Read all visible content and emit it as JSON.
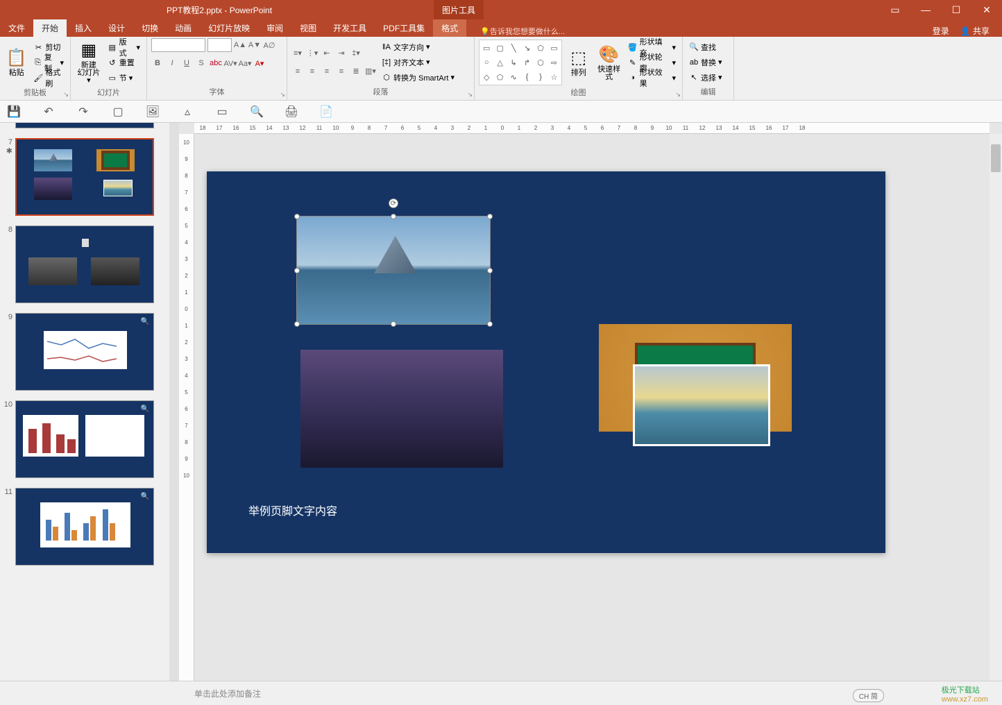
{
  "app": {
    "title": "PPT教程2.pptx - PowerPoint",
    "context_tool": "图片工具"
  },
  "tabs": {
    "file": "文件",
    "home": "开始",
    "insert": "插入",
    "design": "设计",
    "transitions": "切换",
    "animations": "动画",
    "slideshow": "幻灯片放映",
    "review": "审阅",
    "view": "视图",
    "developer": "开发工具",
    "pdf": "PDF工具集",
    "format": "格式"
  },
  "tell_me": "告诉我您想要做什么...",
  "header_right": {
    "login": "登录",
    "share": "共享"
  },
  "ribbon": {
    "clipboard": {
      "label": "剪贴板",
      "paste": "粘贴",
      "cut": "剪切",
      "copy": "复制",
      "format_painter": "格式刷"
    },
    "slides": {
      "label": "幻灯片",
      "new_slide": "新建",
      "new_slide2": "幻灯片",
      "layout": "版式",
      "reset": "重置",
      "section": "节"
    },
    "font": {
      "label": "字体"
    },
    "paragraph": {
      "label": "段落",
      "text_direction": "文字方向",
      "align_text": "对齐文本",
      "convert_smartart": "转换为 SmartArt"
    },
    "drawing": {
      "label": "绘图",
      "arrange": "排列",
      "quick_styles": "快速样式",
      "shape_fill": "形状填充",
      "shape_outline": "形状轮廓",
      "shape_effects": "形状效果"
    },
    "editing": {
      "label": "编辑",
      "find": "查找",
      "replace": "替换",
      "select": "选择"
    }
  },
  "ruler_h": [
    "18",
    "17",
    "16",
    "15",
    "14",
    "13",
    "12",
    "11",
    "10",
    "9",
    "8",
    "7",
    "6",
    "5",
    "4",
    "3",
    "2",
    "1",
    "0",
    "1",
    "2",
    "3",
    "4",
    "5",
    "6",
    "7",
    "8",
    "9",
    "10",
    "11",
    "12",
    "13",
    "14",
    "15",
    "16",
    "17",
    "18"
  ],
  "ruler_v": [
    "10",
    "9",
    "8",
    "7",
    "6",
    "5",
    "4",
    "3",
    "2",
    "1",
    "0",
    "1",
    "2",
    "3",
    "4",
    "5",
    "6",
    "7",
    "8",
    "9",
    "10"
  ],
  "thumbs": {
    "nums": [
      "7",
      "8",
      "9",
      "10",
      "11"
    ],
    "footer": "举例页脚文字内容"
  },
  "slide": {
    "footer": "举例页脚文字内容"
  },
  "notes": {
    "placeholder": "单击此处添加备注"
  },
  "watermark": {
    "line1": "极光下载站",
    "line2": "www.xz7.com"
  },
  "ime": "CH 简"
}
